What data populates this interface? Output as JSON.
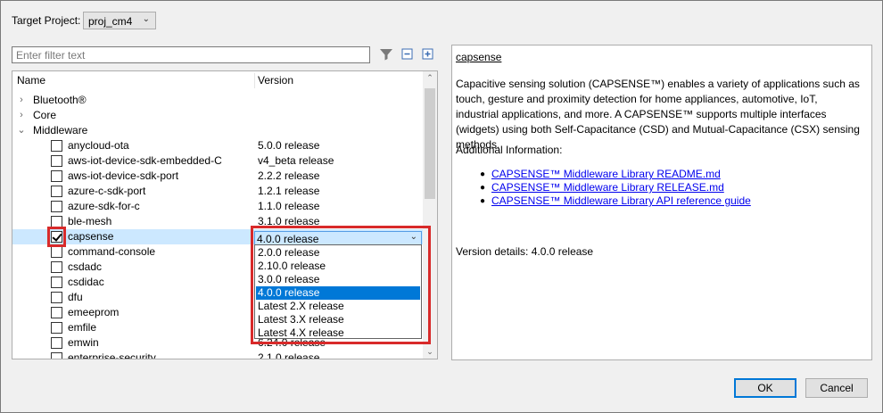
{
  "header": {
    "target_label": "Target Project:",
    "project_value": "proj_cm4"
  },
  "filter": {
    "placeholder": "Enter filter text"
  },
  "tree": {
    "col_name": "Name",
    "col_version": "Version",
    "rows": [
      {
        "name": "Bluetooth®",
        "version": ""
      },
      {
        "name": "Core",
        "version": ""
      },
      {
        "name": "Middleware",
        "version": ""
      },
      {
        "name": "anycloud-ota",
        "version": "5.0.0 release",
        "checked": false
      },
      {
        "name": "aws-iot-device-sdk-embedded-C",
        "version": "v4_beta release",
        "checked": false
      },
      {
        "name": "aws-iot-device-sdk-port",
        "version": "2.2.2 release",
        "checked": false
      },
      {
        "name": "azure-c-sdk-port",
        "version": "1.2.1 release",
        "checked": false
      },
      {
        "name": "azure-sdk-for-c",
        "version": "1.1.0 release",
        "checked": false
      },
      {
        "name": "ble-mesh",
        "version": "3.1.0 release",
        "checked": false
      },
      {
        "name": "capsense",
        "version": "",
        "checked": true
      },
      {
        "name": "command-console",
        "version": "",
        "checked": false
      },
      {
        "name": "csdadc",
        "version": "",
        "checked": false
      },
      {
        "name": "csdidac",
        "version": "",
        "checked": false
      },
      {
        "name": "dfu",
        "version": "",
        "checked": false
      },
      {
        "name": "emeeprom",
        "version": "",
        "checked": false
      },
      {
        "name": "emfile",
        "version": "",
        "checked": false
      },
      {
        "name": "emwin",
        "version": "6.24.0 release",
        "checked": false
      },
      {
        "name": "enterprise-security",
        "version": "2.1.0 release",
        "checked": false
      }
    ]
  },
  "version_dropdown": {
    "selected": "4.0.0 release",
    "options": [
      "2.0.0 release",
      "2.10.0 release",
      "3.0.0 release",
      "4.0.0 release",
      "Latest 2.X release",
      "Latest 3.X release",
      "Latest 4.X release"
    ],
    "selected_index": 3
  },
  "description": {
    "title": "capsense",
    "paragraph": "Capacitive sensing solution (CAPSENSE™) enables a variety of applications such as touch, gesture and proximity detection for home appliances, automotive, IoT, industrial applications, and more. A CAPSENSE™ supports multiple interfaces (widgets) using both Self-Capacitance (CSD) and Mutual-Capacitance (CSX) sensing methods.",
    "additional_label": "Additional Information:",
    "links": [
      "CAPSENSE™ Middleware Library README.md",
      "CAPSENSE™ Middleware Library RELEASE.md",
      "CAPSENSE™ Middleware Library API reference guide"
    ],
    "version_details": "Version details: 4.0.0 release"
  },
  "buttons": {
    "ok": "OK",
    "cancel": "Cancel"
  },
  "colors": {
    "highlight_red": "#d82a2a",
    "selection_blue": "#0078d7",
    "row_selected": "#cce8ff",
    "link": "#0000ee"
  }
}
